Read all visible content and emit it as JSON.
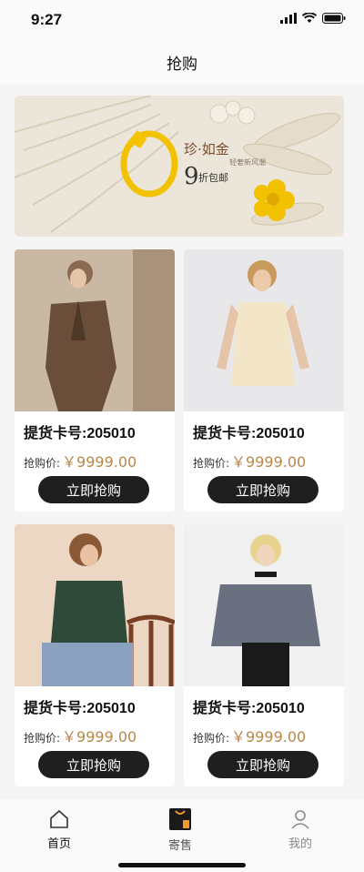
{
  "status_bar": {
    "time": "9:27"
  },
  "nav": {
    "title": "抢购"
  },
  "banner": {
    "brand": "珍·如金",
    "tagline": "轻奢新风潮",
    "discount_num": "9",
    "discount_text": "折包邮"
  },
  "products": [
    {
      "code": "提货卡号:205010",
      "price_label": "抢购价:",
      "price": "￥9999.00",
      "button": "立即抢购"
    },
    {
      "code": "提货卡号:205010",
      "price_label": "抢购价:",
      "price": "￥9999.00",
      "button": "立即抢购"
    },
    {
      "code": "提货卡号:205010",
      "price_label": "抢购价:",
      "price": "￥9999.00",
      "button": "立即抢购"
    },
    {
      "code": "提货卡号:205010",
      "price_label": "抢购价:",
      "price": "￥9999.00",
      "button": "立即抢购"
    }
  ],
  "tabbar": {
    "home": "首页",
    "consign": "寄售",
    "mine": "我的",
    "active": "home"
  },
  "colors": {
    "price": "#b8874c",
    "button": "#1f1f1f",
    "banner_bg": "#ece6da",
    "gold": "#f2c200"
  }
}
